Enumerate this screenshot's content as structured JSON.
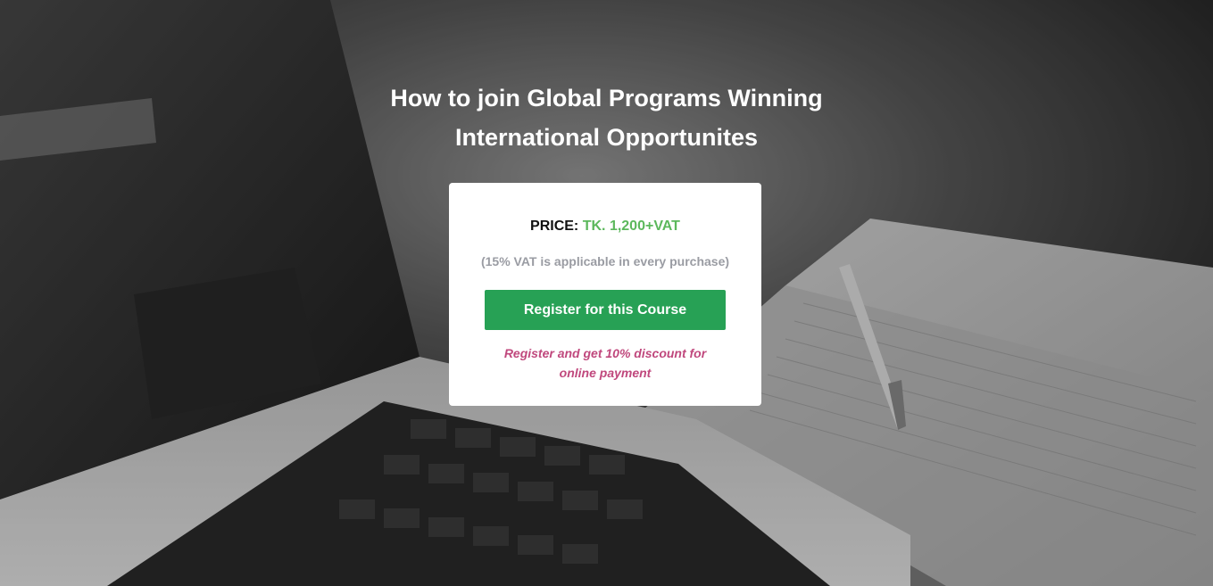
{
  "hero": {
    "title_line1": "How to join Global Programs Winning",
    "title_line2": "International Opportunites",
    "background_image": "laptop-and-notebook-photo"
  },
  "pricing": {
    "price_label": "PRICE:",
    "price_value": "TK. 1,200+VAT",
    "vat_note": "(15% VAT is applicable in every purchase)",
    "register_button": "Register for this Course",
    "discount_line1": "Register and get 10% discount for",
    "discount_line2": "online payment"
  },
  "colors": {
    "price_accent": "#5cb85c",
    "button_green": "#27a155",
    "discount_pink": "#c0487d",
    "note_gray": "#9a9ca3"
  }
}
